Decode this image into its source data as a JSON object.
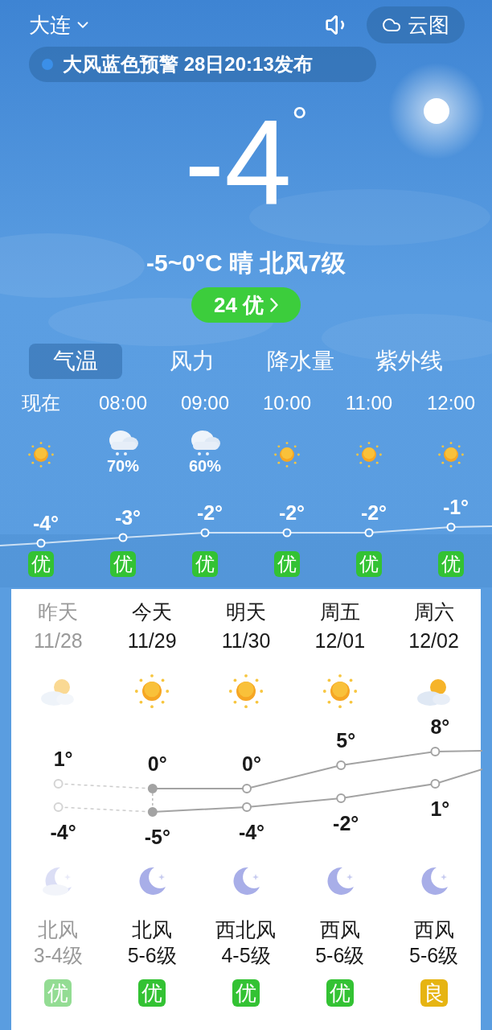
{
  "header": {
    "city": "大连",
    "map_button": "云图"
  },
  "alert": {
    "text": "大风蓝色预警 28日20:13发布",
    "color": "#3b8fe8"
  },
  "current": {
    "temp": "-4",
    "unit": "°",
    "summary": "-5~0°C 晴 北风7级",
    "aqi": "24 优"
  },
  "tabs": [
    {
      "label": "气温",
      "selected": true
    },
    {
      "label": "风力",
      "selected": false
    },
    {
      "label": "降水量",
      "selected": false
    },
    {
      "label": "紫外线",
      "selected": false
    }
  ],
  "hourly": [
    {
      "time": "现在",
      "kind": "sunny",
      "temp": "-4°",
      "aqi": "优",
      "color": "#33c233"
    },
    {
      "time": "08:00",
      "kind": "rain",
      "precip": "70%",
      "temp": "-3°",
      "aqi": "优",
      "color": "#33c233"
    },
    {
      "time": "09:00",
      "kind": "rain",
      "precip": "60%",
      "temp": "-2°",
      "aqi": "优",
      "color": "#33c233"
    },
    {
      "time": "10:00",
      "kind": "sunny",
      "temp": "-2°",
      "aqi": "优",
      "color": "#33c233"
    },
    {
      "time": "11:00",
      "kind": "sunny",
      "temp": "-2°",
      "aqi": "优",
      "color": "#33c233"
    },
    {
      "time": "12:00",
      "kind": "sunny",
      "temp": "-1°",
      "aqi": "优",
      "color": "#33c233"
    }
  ],
  "daily": [
    {
      "day": "昨天",
      "date": "11/28",
      "past": true,
      "day_icon": {
        "kind": "partly-cloudy"
      },
      "high": "1°",
      "low": "-4°",
      "night_icon": {
        "kind": "moon-cloudy"
      },
      "wind": "北风",
      "wind_level": "3-4级",
      "aqi": "优",
      "color": "#93dc93"
    },
    {
      "day": "今天",
      "date": "11/29",
      "past": false,
      "day_icon": {
        "kind": "sunny"
      },
      "high": "0°",
      "low": "-5°",
      "night_icon": {
        "kind": "moon"
      },
      "wind": "北风",
      "wind_level": "5-6级",
      "aqi": "优",
      "color": "#33c233"
    },
    {
      "day": "明天",
      "date": "11/30",
      "past": false,
      "day_icon": {
        "kind": "sunny"
      },
      "high": "0°",
      "low": "-4°",
      "night_icon": {
        "kind": "moon"
      },
      "wind": "西北风",
      "wind_level": "4-5级",
      "aqi": "优",
      "color": "#33c233"
    },
    {
      "day": "周五",
      "date": "12/01",
      "past": false,
      "day_icon": {
        "kind": "sunny"
      },
      "high": "5°",
      "low": "-2°",
      "night_icon": {
        "kind": "moon"
      },
      "wind": "西风",
      "wind_level": "5-6级",
      "aqi": "优",
      "color": "#33c233"
    },
    {
      "day": "周六",
      "date": "12/02",
      "past": false,
      "day_icon": {
        "kind": "partly-cloudy"
      },
      "high": "8°",
      "low": "1°",
      "night_icon": {
        "kind": "moon"
      },
      "wind": "西风",
      "wind_level": "5-6级",
      "aqi": "良",
      "color": "#e6b412"
    }
  ]
}
